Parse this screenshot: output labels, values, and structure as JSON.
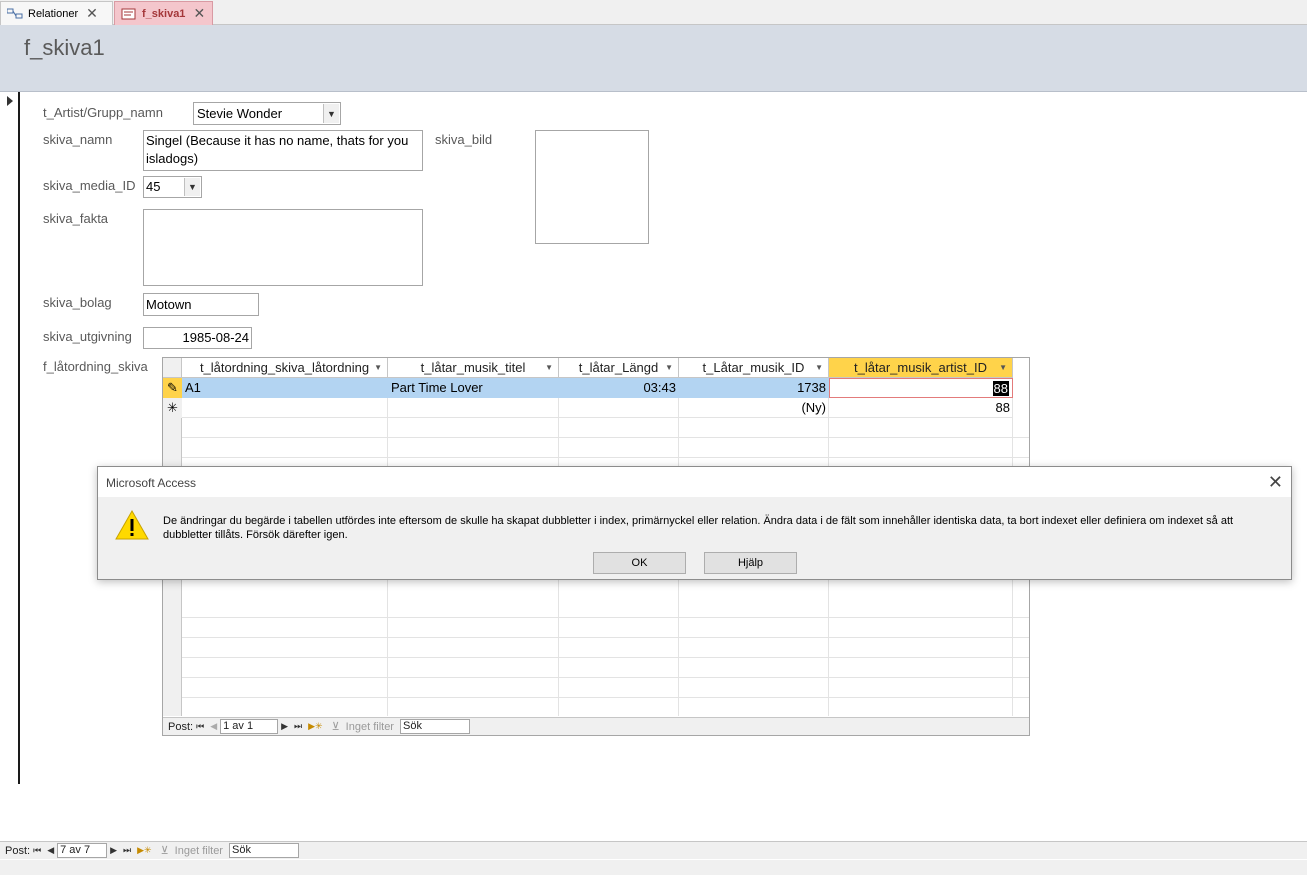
{
  "tabs": [
    {
      "label": "Relationer",
      "icon": "relationships-icon"
    },
    {
      "label": "f_skiva1",
      "icon": "form-icon"
    }
  ],
  "form": {
    "title": "f_skiva1",
    "fields": {
      "artist_label": "t_Artist/Grupp_namn",
      "artist_value": "Stevie Wonder",
      "namn_label": "skiva_namn",
      "namn_value": "Singel (Because it has no name, thats for you isladogs)",
      "bild_label": "skiva_bild",
      "media_label": "skiva_media_ID",
      "media_value": "45",
      "fakta_label": "skiva_fakta",
      "fakta_value": "",
      "bolag_label": "skiva_bolag",
      "bolag_value": "Motown",
      "utgivning_label": "skiva_utgivning",
      "utgivning_value": "1985-08-24",
      "subform_label": "f_låtordning_skiva"
    }
  },
  "subform": {
    "columns": [
      "t_låtordning_skiva_låtordning",
      "t_låtar_musik_titel",
      "t_låtar_Längd",
      "t_Låtar_musik_ID",
      "t_låtar_musik_artist_ID"
    ],
    "rows": [
      {
        "cells": [
          "A1",
          "Part Time Lover",
          "03:43",
          "1738",
          "88"
        ]
      }
    ],
    "new_row": {
      "musik_id": "(Ny)",
      "artist_id": "88"
    },
    "nav": {
      "label": "Post:",
      "position": "1 av 1",
      "filter": "Inget filter",
      "search": "Sök"
    }
  },
  "main_nav": {
    "label": "Post:",
    "position": "7 av 7",
    "filter": "Inget filter",
    "search": "Sök"
  },
  "dialog": {
    "title": "Microsoft Access",
    "message": "De ändringar du begärde i tabellen utfördes inte eftersom de skulle ha skapat dubbletter i index, primärnyckel eller relation. Ändra data i de fält som innehåller identiska data, ta bort indexet eller definiera om indexet så att dubbletter tillåts. Försök därefter igen.",
    "ok_label": "OK",
    "help_label": "Hjälp",
    "icon": "warning-icon"
  },
  "colors": {
    "header_bg": "#d6dce5",
    "selected_col": "#ffd34a",
    "selected_row": "#b3d4f2",
    "active_tab": "#f4c6cc"
  }
}
